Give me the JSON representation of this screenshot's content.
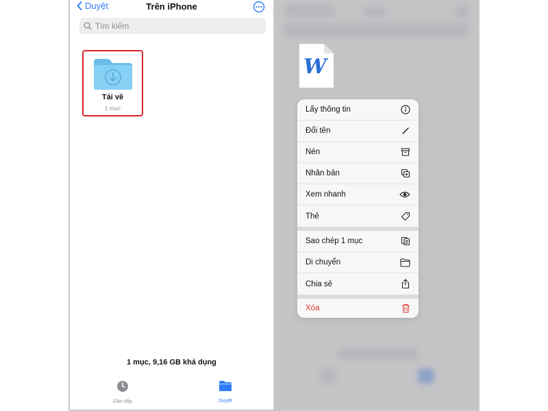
{
  "left_screen": {
    "nav": {
      "back_label": "Duyệt",
      "title": "Trên iPhone"
    },
    "search": {
      "placeholder": "Tìm kiếm"
    },
    "folder": {
      "name": "Tải về",
      "count": "1 mục"
    },
    "storage_text": "1 mục, 9,16 GB khả dụng",
    "tabs": [
      {
        "label": "Gần đây",
        "icon": "clock-icon"
      },
      {
        "label": "Duyệt",
        "icon": "folder-icon",
        "active": true
      }
    ]
  },
  "right_screen": {
    "document_icon_letter": "W",
    "context_menu": {
      "items": [
        {
          "label": "Lấy thông tin",
          "icon": "info-icon"
        },
        {
          "label": "Đổi tên",
          "icon": "pencil-icon"
        },
        {
          "label": "Nén",
          "icon": "archive-box-icon"
        },
        {
          "label": "Nhân bản",
          "icon": "duplicate-icon"
        },
        {
          "label": "Xem nhanh",
          "icon": "eye-icon"
        },
        {
          "label": "Thẻ",
          "icon": "tag-icon"
        },
        {
          "label": "Sao chép 1 mục",
          "icon": "copy-icon"
        },
        {
          "label": "Di chuyển",
          "icon": "folder-icon"
        },
        {
          "label": "Chia sẻ",
          "icon": "share-icon"
        },
        {
          "label": "Xóa",
          "icon": "trash-icon",
          "destructive": true
        }
      ]
    }
  },
  "colors": {
    "accent": "#2f7cf6",
    "highlight_border": "#d9232f",
    "destructive": "#e0352b",
    "folder": "#7ecbf2",
    "word_blue": "#2b6fd6"
  }
}
